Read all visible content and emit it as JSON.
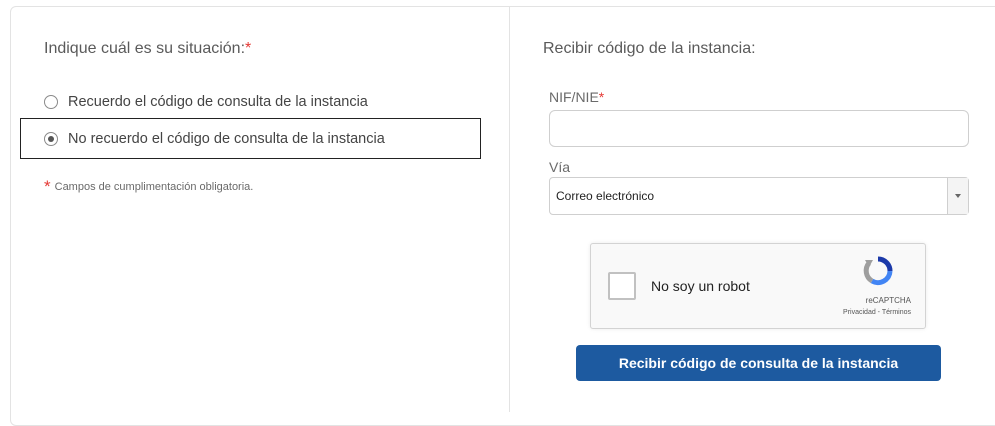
{
  "situation": {
    "title": "Indique cuál es su situación:",
    "required_mark": "*",
    "options": [
      {
        "label": "Recuerdo el código de consulta de la instancia",
        "selected": false
      },
      {
        "label": "No recuerdo el código de consulta de la instancia",
        "selected": true
      }
    ],
    "note_mark": "*",
    "note": "Campos de cumplimentación obligatoria."
  },
  "receive": {
    "title": "Recibir código de la instancia:",
    "nif_label": "NIF/NIE",
    "nif_required_mark": "*",
    "nif_value": "",
    "via_label": "Vía",
    "via_selected": "Correo electrónico",
    "captcha": {
      "label": "No soy un robot",
      "brand": "reCAPTCHA",
      "terms": "Privacidad - Términos"
    },
    "submit_label": "Recibir código de consulta de la instancia"
  },
  "colors": {
    "required": "#e53935",
    "primary_button": "#1d5aa0"
  }
}
